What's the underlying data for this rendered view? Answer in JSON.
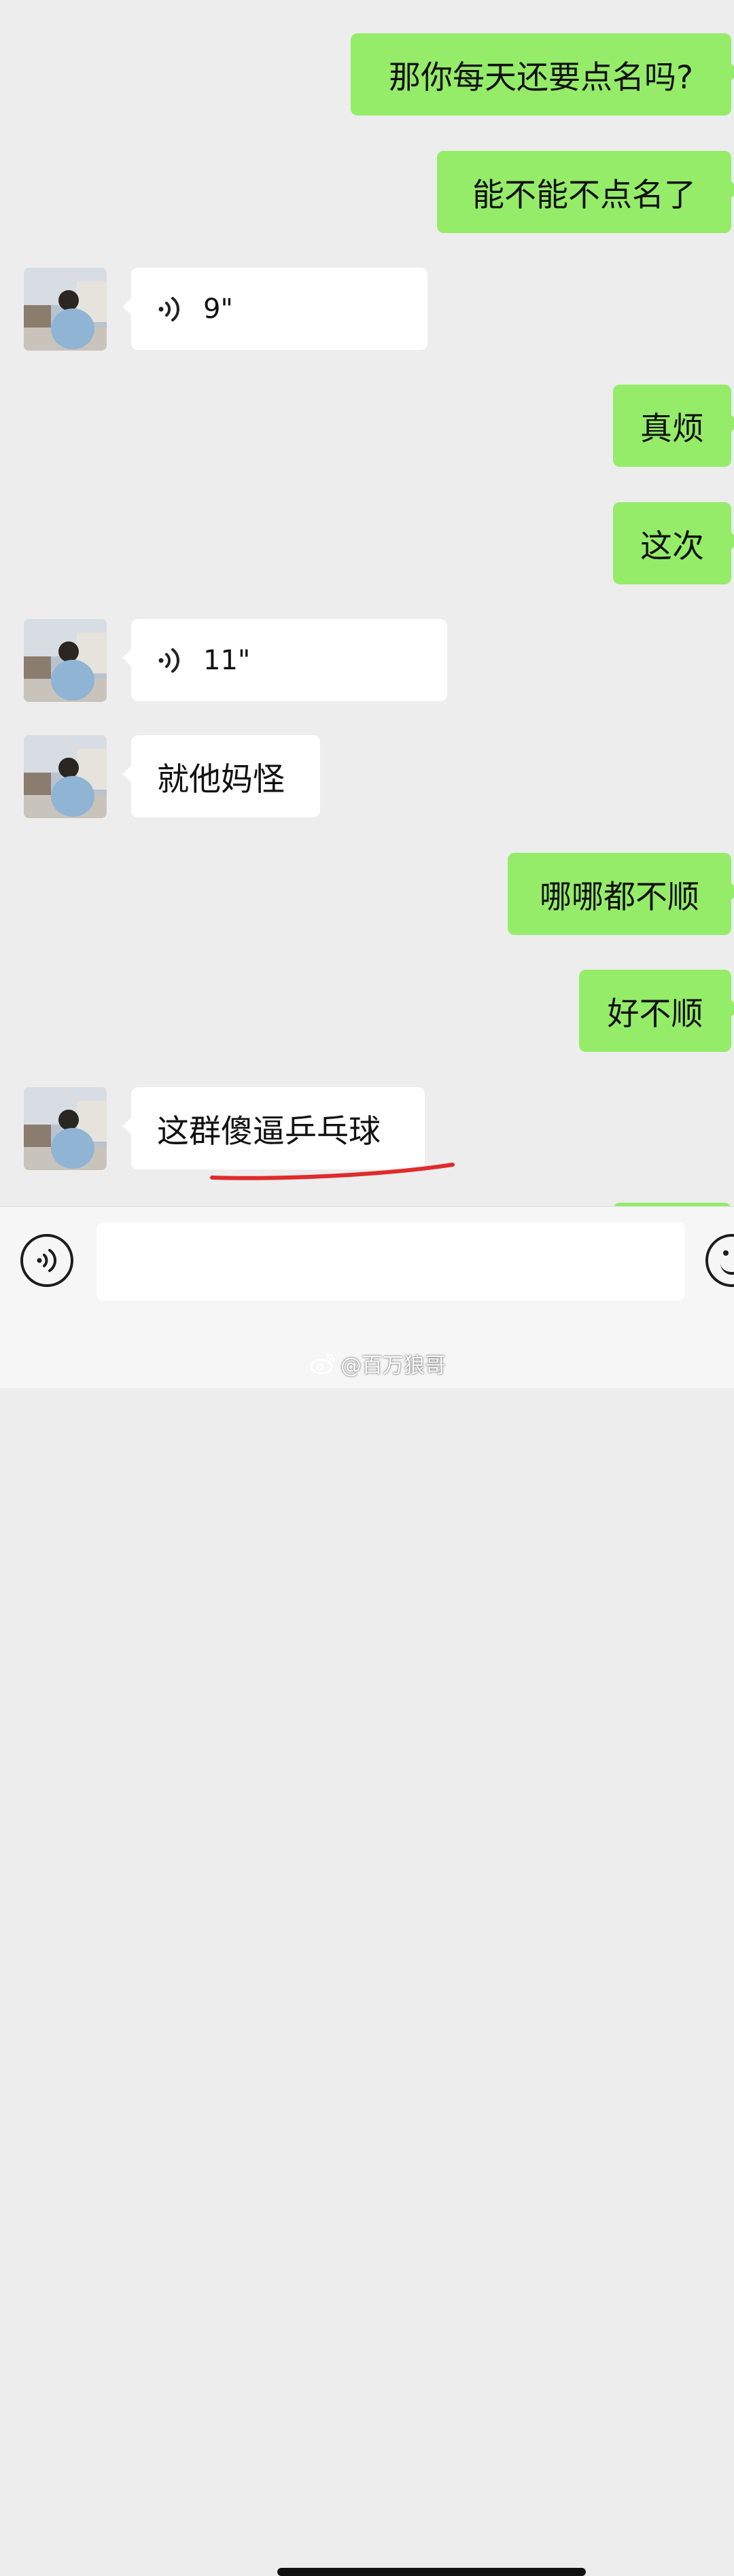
{
  "messages": [
    {
      "side": "me",
      "text": "那你每天还要点名吗?"
    },
    {
      "side": "me",
      "text": "能不能不点名了"
    },
    {
      "side": "them",
      "type": "voice",
      "duration": "9\""
    },
    {
      "side": "me",
      "text": "真烦"
    },
    {
      "side": "me",
      "text": "这次"
    },
    {
      "side": "them",
      "type": "voice",
      "duration": "11\""
    },
    {
      "side": "them",
      "text": "就他妈怪"
    },
    {
      "side": "me",
      "text": "哪哪都不顺"
    },
    {
      "side": "me",
      "text": "好不顺"
    },
    {
      "side": "them",
      "text": "这群傻逼乒乓球"
    }
  ],
  "input_bar": {
    "voice_icon": "voice-icon",
    "emoji_icon": "emoji-icon",
    "input_value": ""
  },
  "watermark": {
    "logo": "weibo-logo",
    "text": "@百万狼哥"
  },
  "colors": {
    "background": "#ededed",
    "my_bubble": "#95ec69",
    "their_bubble": "#ffffff",
    "annotation_line": "#e02b2b"
  }
}
